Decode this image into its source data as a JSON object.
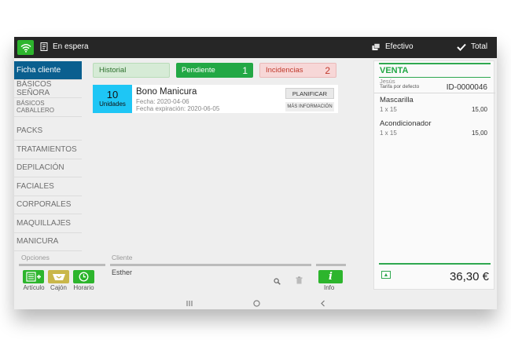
{
  "topbar": {
    "hold_label": "En espera",
    "payment_label": "Efectivo",
    "total_label": "Total"
  },
  "sidebar": {
    "items": [
      {
        "label": "Ficha cliente"
      },
      {
        "label": "BÁSICOS SEÑORA"
      },
      {
        "label": "BÁSICOS CABALLERO"
      },
      {
        "label": "PACKS"
      },
      {
        "label": "TRATAMIENTOS"
      },
      {
        "label": "DEPILACIÓN"
      },
      {
        "label": "FACIALES"
      },
      {
        "label": "CORPORALES"
      },
      {
        "label": "MAQUILLAJES"
      },
      {
        "label": "MANICURA"
      }
    ]
  },
  "tabs": {
    "historial": {
      "label": "Historial"
    },
    "pendiente": {
      "label": "Pendiente",
      "count": "1"
    },
    "incidencias": {
      "label": "Incidencias",
      "count": "2"
    }
  },
  "bono": {
    "units_count": "10",
    "units_label": "Unidades",
    "title": "Bono Manicura",
    "fecha": "Fecha: 2020-04-06",
    "expiracion": "Fecha expiración: 2020-06-05",
    "plan_label": "PLANIFICAR",
    "more_label": "MÁS INFORMACIÓN"
  },
  "sale": {
    "title": "VENTA",
    "customer": "Jesús",
    "tarifa": "Tarifa por defecto",
    "id": "ID-0000046",
    "lines": [
      {
        "name": "Mascarilla",
        "qty": "1 x 15",
        "price": "15,00"
      },
      {
        "name": "Acondicionador",
        "qty": "1 x 15",
        "price": "15,00"
      }
    ],
    "total": "36,30 €"
  },
  "options": {
    "title": "Opciones",
    "items": [
      {
        "label": "Artículo"
      },
      {
        "label": "Cajón"
      },
      {
        "label": "Horario"
      }
    ]
  },
  "client": {
    "title": "Cliente",
    "name": "Esther"
  },
  "info": {
    "label": "Info"
  },
  "colors": {
    "accent_green": "#2db52d",
    "active_blue": "#0a5f8f",
    "units_cyan": "#1ec6f5",
    "incident_red": "#c0392b"
  }
}
